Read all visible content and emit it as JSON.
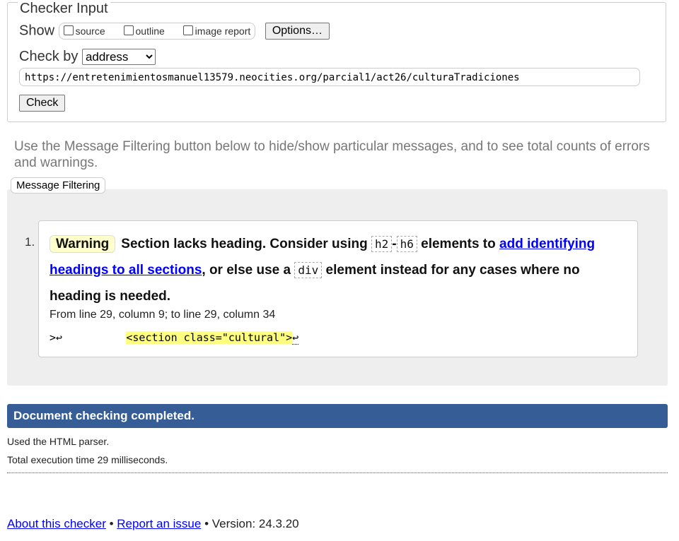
{
  "checker_input": {
    "legend": "Checker Input",
    "show_label": "Show",
    "show_options": [
      "source",
      "outline",
      "image report"
    ],
    "options_button": "Options…",
    "check_by_label": "Check by",
    "check_by_value": "address",
    "url": "https://entretenimientosmanuel13579.neocities.org/parcial1/act26/culturaTradiciones",
    "check_button": "Check"
  },
  "intro": "Use the Message Filtering button below to hide/show particular messages, and to see total counts of errors and warnings.",
  "message_filtering": "Message Filtering",
  "messages": [
    {
      "number": "1.",
      "type": "Warning",
      "t1": "Section lacks heading. Consider using ",
      "c1": "h2",
      "dash": "-",
      "c2": "h6",
      "t2": " elements to ",
      "link": "add identifying headings to all sections",
      "t3": ", or else use a ",
      "c3": "div",
      "t4": " element instead for any cases where no heading is needed.",
      "location": "From line 29, column 9; to line 29, column 34",
      "extract_pre": ">↩          ",
      "extract_hl": "<section class=\"cultural\">",
      "extract_post": "↩"
    }
  ],
  "completed": "Document checking completed.",
  "parser": "Used the HTML parser.",
  "exec_time": "Total execution time 29 milliseconds.",
  "footer": {
    "about": "About this checker",
    "sep": " • ",
    "report": "Report an issue",
    "version": "Version: 24.3.20"
  }
}
